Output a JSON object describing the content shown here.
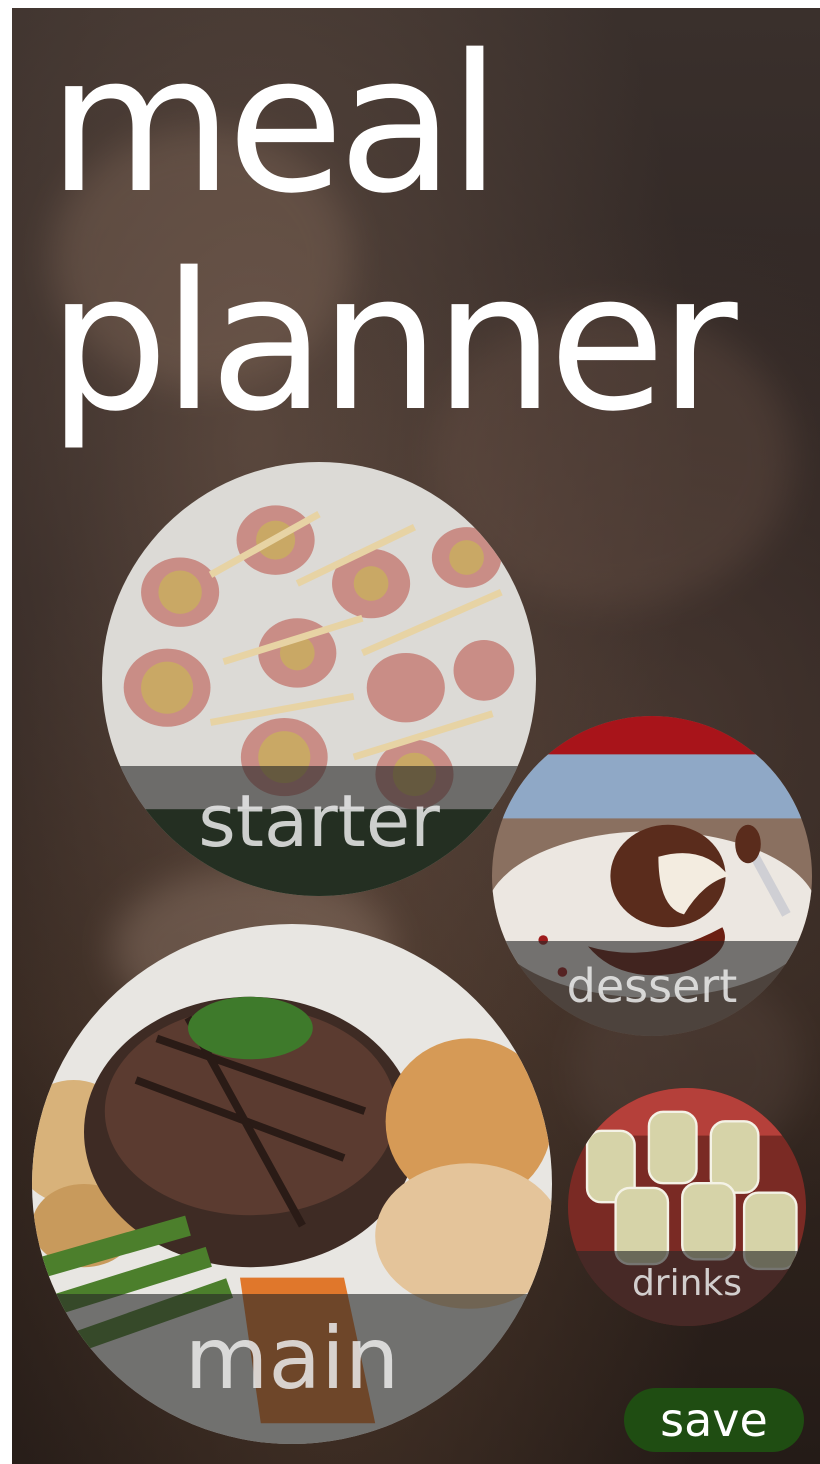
{
  "app": {
    "title_line1": "meal",
    "title_line2": "planner"
  },
  "courses": [
    {
      "label": "starter",
      "icon": "starter-photo"
    },
    {
      "label": "dessert",
      "icon": "dessert-photo"
    },
    {
      "label": "main",
      "icon": "main-photo"
    },
    {
      "label": "drinks",
      "icon": "drinks-photo"
    }
  ],
  "actions": {
    "save_label": "save"
  },
  "colors": {
    "save_button": "#1f4d12",
    "label_band": "#282828",
    "title_text": "#ffffff"
  }
}
